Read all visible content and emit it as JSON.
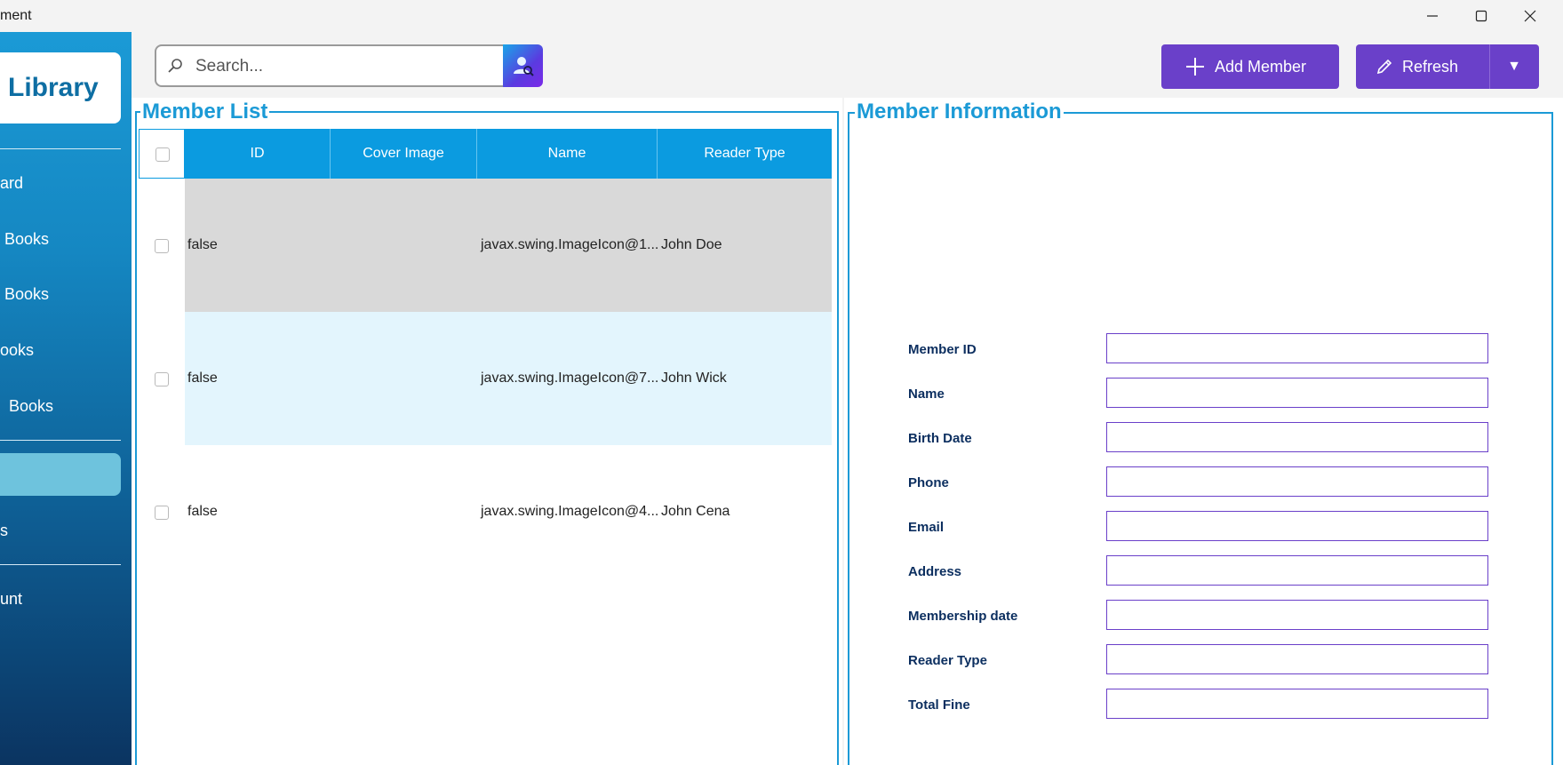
{
  "window": {
    "title": "ment",
    "controls": [
      "minimize-icon",
      "maximize-icon",
      "close-icon"
    ]
  },
  "colors": {
    "primary_button": "#6a40c9",
    "accent_blue": "#1b9ad6",
    "table_header": "#0b9be0",
    "row_selected": "#d9d9d9",
    "row_hover": "#e3f5fd",
    "label_text": "#0b2e5f"
  },
  "sidebar": {
    "logo": "Library",
    "items": [
      {
        "label": "ard"
      },
      {
        "label": " Books"
      },
      {
        "label": " Books"
      },
      {
        "label": "ooks"
      },
      {
        "label": "  Books"
      },
      {
        "label": ""
      },
      {
        "label": "s"
      },
      {
        "label": "unt"
      }
    ]
  },
  "toolbar": {
    "search_placeholder": "Search...",
    "search_button_icon": "user-search-icon",
    "add_member_label": "Add Member",
    "refresh_label": "Refresh",
    "dropdown_glyph": "▼"
  },
  "member_list": {
    "title": "Member List",
    "columns": [
      "ID",
      "Cover Image",
      "Name",
      "Reader Type"
    ],
    "rows": [
      {
        "checked": false,
        "id": "false",
        "cover_image": "javax.swing.ImageIcon@1...",
        "name": "John Doe",
        "reader_type": ""
      },
      {
        "checked": false,
        "id": "false",
        "cover_image": "javax.swing.ImageIcon@7...",
        "name": "John Wick",
        "reader_type": ""
      },
      {
        "checked": false,
        "id": "false",
        "cover_image": "javax.swing.ImageIcon@4...",
        "name": "John Cena",
        "reader_type": ""
      }
    ]
  },
  "member_info": {
    "title": "Member Information",
    "fields": [
      {
        "label": "Member ID",
        "value": ""
      },
      {
        "label": "Name",
        "value": ""
      },
      {
        "label": "Birth Date",
        "value": ""
      },
      {
        "label": "Phone",
        "value": ""
      },
      {
        "label": "Email",
        "value": ""
      },
      {
        "label": "Address",
        "value": ""
      },
      {
        "label": "Membership date",
        "value": ""
      },
      {
        "label": "Reader Type",
        "value": ""
      },
      {
        "label": "Total Fine",
        "value": ""
      }
    ]
  }
}
